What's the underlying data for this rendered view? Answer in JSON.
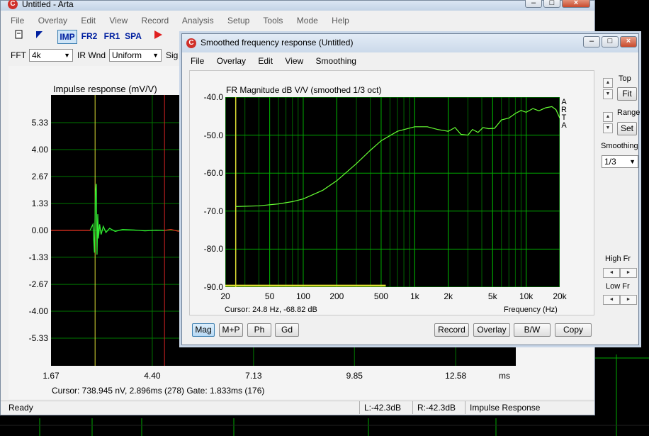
{
  "main_window": {
    "title": "Untitled - Arta",
    "app_icon_letter": "C",
    "menu": [
      "File",
      "Overlay",
      "Edit",
      "View",
      "Record",
      "Analysis",
      "Setup",
      "Tools",
      "Mode",
      "Help"
    ],
    "toolbar_modes": [
      "IMP",
      "FR2",
      "FR1",
      "SPA"
    ],
    "controls": {
      "fft_label": "FFT",
      "fft_value": "4k",
      "ir_wnd_label": "IR Wnd",
      "ir_wnd_value": "Uniform",
      "sig_label": "Sig W"
    },
    "plot_title": "Impulse response (mV/V)",
    "cursor_text": "Cursor: 738.945 nV, 2.896ms (278)  Gate: 1.833ms (176)",
    "status": {
      "ready": "Ready",
      "left": "L:-42.3dB",
      "right": "R:-42.3dB",
      "mode": "Impulse Response"
    }
  },
  "fr_window": {
    "title": "Smoothed frequency response (Untitled)",
    "app_icon_letter": "C",
    "menu": [
      "File",
      "Overlay",
      "Edit",
      "View",
      "Smoothing"
    ],
    "plot_title": "FR Magnitude dB V/V (smoothed 1/3 oct)",
    "arta_label": [
      "A",
      "R",
      "T",
      "A"
    ],
    "cursor_text": "Cursor: 24.8 Hz, -68.82 dB",
    "xlabel": "Frequency (Hz)",
    "side": {
      "top_label": "Top",
      "fit_label": "Fit",
      "range_label": "Range",
      "set_label": "Set",
      "smoothing_label": "Smoothing",
      "smoothing_value": "1/3",
      "high_fr_label": "High Fr",
      "low_fr_label": "Low Fr"
    },
    "bottom_buttons_left": [
      "Mag",
      "M+P",
      "Ph",
      "Gd"
    ],
    "bottom_buttons_right": [
      "Record",
      "Overlay",
      "B/W",
      "Copy"
    ]
  },
  "chart_data": [
    {
      "type": "line",
      "title": "Impulse response (mV/V)",
      "xlabel": "ms",
      "ylabel": "",
      "x_ticks": [
        "1.67",
        "4.40",
        "7.13",
        "9.85",
        "12.58",
        "ms"
      ],
      "y_ticks": [
        "5.33",
        "4.00",
        "2.67",
        "1.33",
        "0.00",
        "-1.33",
        "-2.67",
        "-4.00",
        "-5.33"
      ],
      "xlim": [
        1.67,
        14.2
      ],
      "ylim": [
        -6.7,
        6.7
      ],
      "grid": true,
      "cursor_x": 2.896,
      "gate_x": 4.73,
      "series": [
        {
          "color": "#33ee33",
          "x": [
            2.72,
            2.8,
            2.84,
            2.87,
            2.89,
            2.91,
            2.93,
            2.95,
            2.98,
            3.02,
            3.08,
            3.15,
            3.25,
            3.4,
            3.6,
            3.9,
            4.2,
            4.5,
            4.73
          ],
          "y": [
            0,
            0.3,
            -1.1,
            1.9,
            2.3,
            -1.2,
            0.8,
            -0.4,
            0.3,
            -0.2,
            0.2,
            -0.1,
            0.1,
            -0.05,
            0.05,
            0.02,
            -0.02,
            0.01,
            0
          ]
        },
        {
          "color": "#ee3322",
          "x": [
            1.67,
            2.72
          ],
          "y": [
            0,
            0
          ]
        },
        {
          "color": "#ee3322",
          "x": [
            4.73,
            4.9,
            5.1,
            5.3,
            5.5
          ],
          "y": [
            0,
            0.05,
            -0.04,
            0.03,
            0
          ]
        }
      ]
    },
    {
      "type": "line",
      "title": "FR Magnitude dB V/V (smoothed 1/3 oct)",
      "xlabel": "Frequency (Hz)",
      "ylabel": "",
      "x_scale": "log",
      "x_ticks": [
        20,
        50,
        100,
        200,
        500,
        1000,
        2000,
        5000,
        10000,
        20000
      ],
      "x_tick_labels": [
        "20",
        "50",
        "100",
        "200",
        "500",
        "1k",
        "2k",
        "5k",
        "10k",
        "20k"
      ],
      "y_ticks": [
        -40,
        -50,
        -60,
        -70,
        -80,
        -90
      ],
      "y_tick_labels": [
        "-40.0",
        "-50.0",
        "-60.0",
        "-70.0",
        "-80.0",
        "-90.0"
      ],
      "xlim": [
        20,
        20000
      ],
      "ylim": [
        -90,
        -40
      ],
      "grid": true,
      "cursor_x": 24.8,
      "series": [
        {
          "color": "#66ff33",
          "x": [
            24.8,
            40,
            60,
            80,
            100,
            150,
            200,
            300,
            400,
            500,
            700,
            1000,
            1300,
            1600,
            2000,
            2300,
            2600,
            3000,
            3300,
            3700,
            4100,
            4600,
            5200,
            6000,
            7000,
            8000,
            9000,
            10000,
            11500,
            13000,
            15000,
            17000,
            18500,
            20000
          ],
          "y": [
            -68.8,
            -68.6,
            -68.1,
            -67.5,
            -66.8,
            -64.5,
            -62.0,
            -57.5,
            -54.0,
            -51.5,
            -49.0,
            -47.8,
            -47.8,
            -48.5,
            -49.0,
            -48.0,
            -49.8,
            -50.0,
            -48.5,
            -49.3,
            -48.0,
            -48.3,
            -48.2,
            -46.0,
            -45.5,
            -44.3,
            -43.5,
            -44.0,
            -43.0,
            -43.6,
            -42.8,
            -42.5,
            -43.3,
            -45.5
          ]
        },
        {
          "color": "#dddd33",
          "x": [
            20,
            550
          ],
          "y": [
            -89.6,
            -89.6
          ]
        }
      ]
    }
  ]
}
